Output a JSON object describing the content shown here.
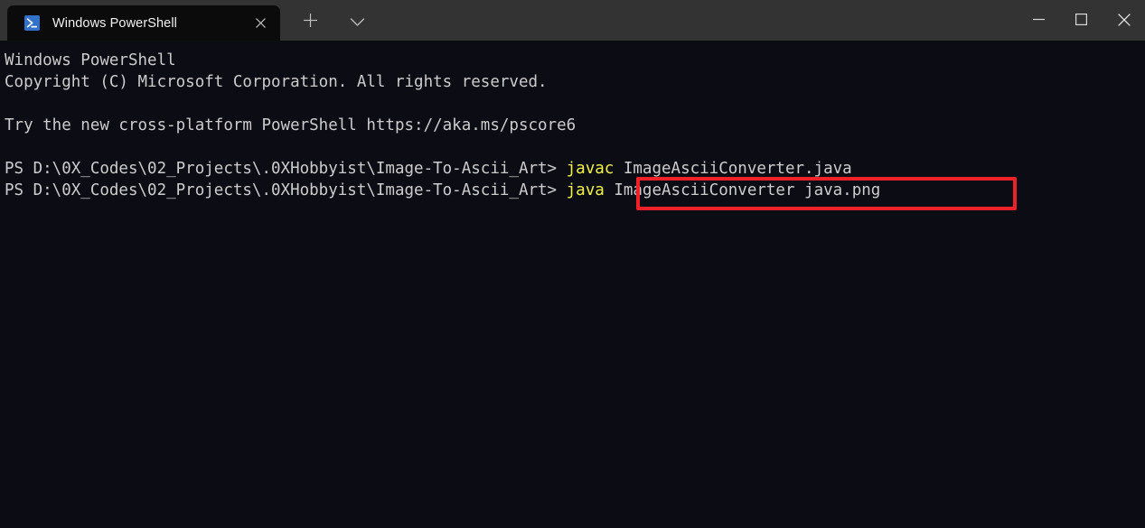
{
  "window": {
    "app_title": "Windows PowerShell",
    "tab": {
      "icon": "powershell-icon",
      "label": "Windows PowerShell",
      "close_icon": "close-icon"
    },
    "new_tab_icon": "plus-icon",
    "tab_dropdown_icon": "chevron-down-icon",
    "controls": {
      "minimize_icon": "minimize-icon",
      "maximize_icon": "maximize-icon",
      "close_icon": "close-icon"
    },
    "colors": {
      "titlebar_bg": "#333333",
      "active_tab_bg": "#0B0B0B",
      "terminal_bg": "#0C0C14",
      "text": "#CCCCCC",
      "command_yellow": "#F2F24B",
      "highlight_red": "#EE2028",
      "powershell_blue": "#3272C8"
    }
  },
  "terminal": {
    "prompt_prefix": "PS D:\\0X_Codes\\02_Projects\\.0XHobbyist\\Image-To-Ascii_Art>",
    "lines": [
      {
        "name": "banner-title",
        "segments": [
          {
            "text": "Windows PowerShell",
            "color": "white"
          }
        ]
      },
      {
        "name": "banner-copyright",
        "segments": [
          {
            "text": "Copyright (C) Microsoft Corporation. All rights reserved.",
            "color": "white"
          }
        ]
      },
      {
        "name": "blank-line-1",
        "segments": [
          {
            "text": "",
            "color": "white"
          }
        ]
      },
      {
        "name": "banner-promo",
        "segments": [
          {
            "text": "Try the new cross-platform PowerShell https://aka.ms/pscore6",
            "color": "white"
          }
        ]
      },
      {
        "name": "blank-line-2",
        "segments": [
          {
            "text": "",
            "color": "white"
          }
        ]
      },
      {
        "name": "command-line-1",
        "segments": [
          {
            "text": "PS D:\\0X_Codes\\02_Projects\\.0XHobbyist\\Image-To-Ascii_Art> ",
            "color": "white"
          },
          {
            "text": "javac",
            "color": "yellow"
          },
          {
            "text": " ImageAsciiConverter.java",
            "color": "white"
          }
        ]
      },
      {
        "name": "command-line-2",
        "segments": [
          {
            "text": "PS D:\\0X_Codes\\02_Projects\\.0XHobbyist\\Image-To-Ascii_Art> ",
            "color": "white"
          },
          {
            "text": "java",
            "color": "yellow"
          },
          {
            "text": " ImageAsciiConverter java.png",
            "color": "white"
          }
        ]
      }
    ],
    "highlight": {
      "name": "highlighted-command",
      "text": "java ImageAsciiConverter java.png",
      "color": "#EE2028"
    }
  }
}
